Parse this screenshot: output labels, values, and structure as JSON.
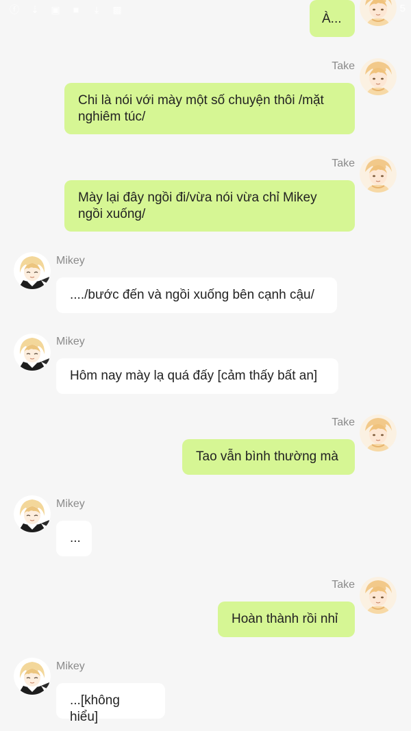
{
  "status_bar": {
    "left_icons": [
      "facebook-icon",
      "download-icon",
      "image-icon",
      "square-icon",
      "download-icon",
      "app-icon"
    ],
    "right_text": "5"
  },
  "colors": {
    "outgoing_bubble": "#d6f694",
    "incoming_bubble": "#ffffff",
    "background": "#f6f6f6"
  },
  "messages": [
    {
      "sender": "",
      "side": "out",
      "text": "À..."
    },
    {
      "sender": "Take",
      "side": "out",
      "text": "Chi là nói với mày một số chuyện thôi /mặt nghiêm túc/"
    },
    {
      "sender": "Take",
      "side": "out",
      "text": "Mày lại đây ngồi đi/vừa nói vừa chỉ Mikey ngồi xuống/"
    },
    {
      "sender": "Mikey",
      "side": "in",
      "text": "..../bước đến và ngồi xuống bên cạnh cậu/"
    },
    {
      "sender": "Mikey",
      "side": "in",
      "text": "Hôm nay mày lạ quá đấy [cảm thấy bất an]"
    },
    {
      "sender": "Take",
      "side": "out",
      "text": "Tao vẫn bình thường mà"
    },
    {
      "sender": "Mikey",
      "side": "in",
      "text": "..."
    },
    {
      "sender": "Take",
      "side": "out",
      "text": "Hoàn thành rồi nhỉ"
    },
    {
      "sender": "Mikey",
      "side": "in",
      "text": "...[không hiểu]"
    }
  ]
}
